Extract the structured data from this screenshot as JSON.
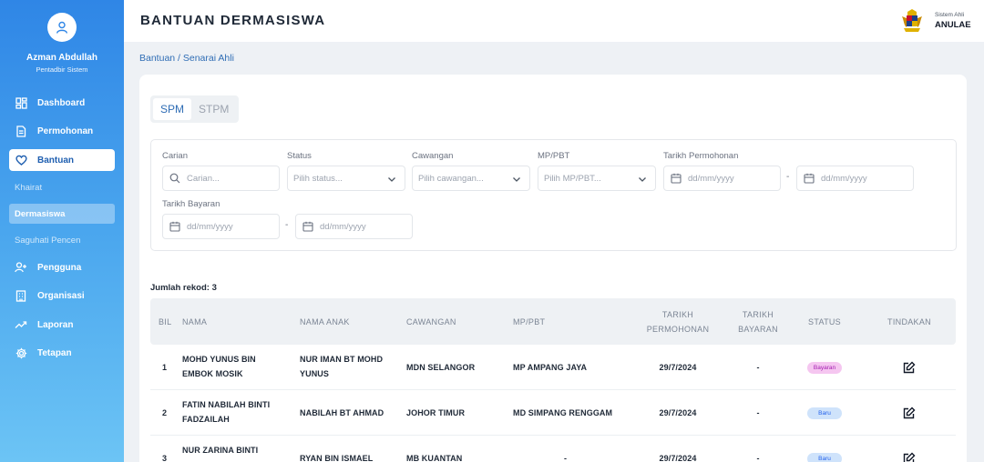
{
  "user": {
    "name": "Azman Abdullah",
    "role": "Pentadbir Sistem"
  },
  "nav": {
    "dashboard": "Dashboard",
    "permohonan": "Permohonan",
    "bantuan": "Bantuan",
    "sub": {
      "khairat": "Khairat",
      "dermasiswa": "Dermasiswa",
      "saguhati": "Saguhati Pencen"
    },
    "pengguna": "Pengguna",
    "organisasi": "Organisasi",
    "laporan": "Laporan",
    "tetapan": "Tetapan"
  },
  "header": {
    "title": "BANTUAN DERMASISWA",
    "system_label": "Sistem Ahli",
    "system_name": "ANULAE"
  },
  "breadcrumb": "Bantuan / Senarai Ahli",
  "tabs": [
    "SPM",
    "STPM"
  ],
  "filters": {
    "carian": {
      "label": "Carian",
      "placeholder": "Carian..."
    },
    "status": {
      "label": "Status",
      "placeholder": "Pilih status..."
    },
    "cawangan": {
      "label": "Cawangan",
      "placeholder": "Pilih cawangan..."
    },
    "mppbt": {
      "label": "MP/PBT",
      "placeholder": "Pilih MP/PBT..."
    },
    "tarikh_permohonan": {
      "label": "Tarikh Permohonan",
      "from": "dd/mm/yyyy",
      "to": "dd/mm/yyyy"
    },
    "tarikh_bayaran": {
      "label": "Tarikh Bayaran",
      "from": "dd/mm/yyyy",
      "to": "dd/mm/yyyy"
    },
    "range_sep": "-"
  },
  "record_count": "Jumlah rekod: 3",
  "table": {
    "headers": {
      "bil": "BIL",
      "nama": "NAMA",
      "nama_anak": "NAMA ANAK",
      "cawangan": "CAWANGAN",
      "mppbt": "MP/PBT",
      "tarikh_permohonan_1": "TARIKH",
      "tarikh_permohonan_2": "PERMOHONAN",
      "tarikh_bayaran_1": "TARIKH",
      "tarikh_bayaran_2": "BAYARAN",
      "status": "STATUS",
      "tindakan": "TINDAKAN"
    },
    "rows": [
      {
        "bil": "1",
        "nama_1": "MOHD YUNUS BIN",
        "nama_2": "EMBOK MOSIK",
        "anak_1": "NUR IMAN BT MOHD",
        "anak_2": "YUNUS",
        "cawangan": "MDN SELANGOR",
        "mppbt": "MP AMPANG JAYA",
        "tarikh_permohonan": "29/7/2024",
        "tarikh_bayaran": "-",
        "status": "Bayaran"
      },
      {
        "bil": "2",
        "nama_1": "FATIN NABILAH BINTI",
        "nama_2": "FADZAILAH",
        "anak_1": "NABILAH BT AHMAD",
        "anak_2": "",
        "cawangan": "JOHOR TIMUR",
        "mppbt": "MD SIMPANG RENGGAM",
        "tarikh_permohonan": "29/7/2024",
        "tarikh_bayaran": "-",
        "status": "Baru"
      },
      {
        "bil": "3",
        "nama_1": "NUR ZARINA BINTI",
        "nama_2": "",
        "anak_1": "RYAN BIN ISMAEL",
        "anak_2": "",
        "cawangan": "MB KUANTAN",
        "mppbt": "-",
        "tarikh_permohonan": "29/7/2024",
        "tarikh_bayaran": "-",
        "status": "Baru"
      }
    ]
  },
  "colors": {
    "sidebar_top": "#2f86e6",
    "sidebar_bottom": "#6cc4f5",
    "accent": "#2f6db5",
    "badge_bayaran_bg": "#f5c6f0",
    "badge_bayaran_fg": "#a21caf",
    "badge_baru_bg": "#cfe3fb",
    "badge_baru_fg": "#2563eb"
  },
  "icons": [
    "user-icon",
    "dashboard-icon",
    "document-icon",
    "heart-icon",
    "user-plus-icon",
    "building-icon",
    "trending-up-icon",
    "gear-icon",
    "search-icon",
    "chevron-down-icon",
    "calendar-icon",
    "edit-icon",
    "crest-logo"
  ]
}
